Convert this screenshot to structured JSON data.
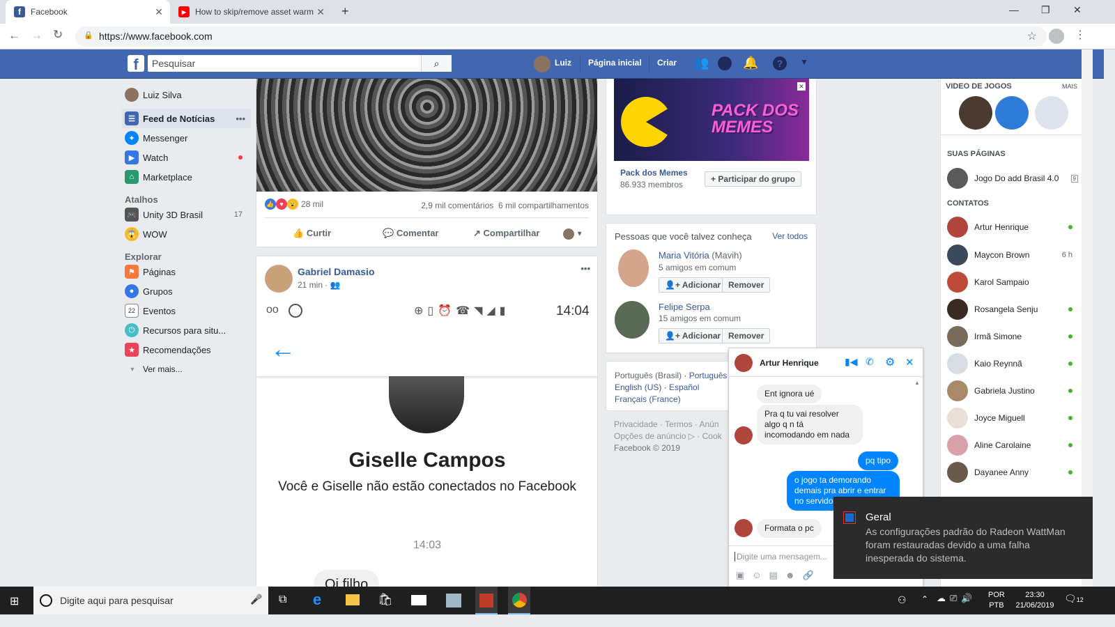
{
  "browser": {
    "tabs": [
      {
        "title": "Facebook",
        "icon": "facebook-icon"
      },
      {
        "title": "How to skip/remove asset warmu",
        "icon": "youtube-icon"
      }
    ],
    "url": "https://www.facebook.com"
  },
  "header": {
    "search_placeholder": "Pesquisar",
    "user_name": "Luiz",
    "home": "Página inicial",
    "create": "Criar"
  },
  "left_nav": {
    "profile": "Luiz Silva",
    "main": [
      {
        "label": "Feed de Notícias",
        "icon": "news-feed-icon"
      },
      {
        "label": "Messenger",
        "icon": "messenger-icon"
      },
      {
        "label": "Watch",
        "icon": "watch-icon"
      },
      {
        "label": "Marketplace",
        "icon": "marketplace-icon"
      }
    ],
    "shortcuts_header": "Atalhos",
    "shortcuts": [
      {
        "label": "Unity 3D Brasil",
        "count": "17"
      },
      {
        "label": "WOW",
        "count": ""
      }
    ],
    "explore_header": "Explorar",
    "explore": [
      {
        "label": "Páginas"
      },
      {
        "label": "Grupos"
      },
      {
        "label": "Eventos"
      },
      {
        "label": "Recursos para situ..."
      },
      {
        "label": "Recomendações"
      }
    ],
    "see_more": "Ver mais..."
  },
  "post1": {
    "reactions": "28 mil",
    "comments": "2,9 mil comentários",
    "shares": "6 mil compartilhamentos",
    "like": "Curtir",
    "comment": "Comentar",
    "share": "Compartilhar"
  },
  "post2": {
    "author": "Gabriel Damasio",
    "time": "21 min",
    "phone_time": "14:04",
    "profile_name": "Giselle Campos",
    "profile_sub": "Você e Giselle não estão conectados no Facebook",
    "msg_time": "14:03",
    "msg": "Oi filho"
  },
  "group_ad": {
    "banner_text": "PACK DOS MEMES",
    "name": "Pack dos Memes",
    "members": "86.933 membros",
    "join": "Participar do grupo"
  },
  "pymk": {
    "title": "Pessoas que você talvez conheça",
    "see_all": "Ver todos",
    "people": [
      {
        "name": "Maria Vitória",
        "alt": "(Mavih)",
        "mutual": "5 amigos em comum"
      },
      {
        "name": "Felipe Serpa",
        "alt": "",
        "mutual": "15 amigos em comum"
      }
    ],
    "add": "Adicionar",
    "remove": "Remover"
  },
  "footer": {
    "lang_current": "Português (Brasil)",
    "langs": [
      "Português",
      "English (US)",
      "Español",
      "Français (France)"
    ],
    "line1": "Privacidade · Termos · Anún",
    "line2": "Opções de anúncio ▷ · Cook",
    "copyright": "Facebook © 2019"
  },
  "right_sidebar": {
    "games_header": "VIDEO DE JOGOS",
    "more": "MAIS",
    "pages_header": "SUAS PÁGINAS",
    "page": "Jogo Do add Brasil 4.0",
    "page_badge": "9",
    "contacts_header": "CONTATOS",
    "contacts": [
      {
        "name": "Artur Henrique",
        "status": "online"
      },
      {
        "name": "Maycon Brown",
        "status": "6 h"
      },
      {
        "name": "Karol Sampaio",
        "status": ""
      },
      {
        "name": "Rosangela Senju",
        "status": "online"
      },
      {
        "name": "Irmã Simone",
        "status": "online"
      },
      {
        "name": "Kaio Reynnã",
        "status": "online"
      },
      {
        "name": "Gabriela Justino",
        "status": "online"
      },
      {
        "name": "Joyce Miguell",
        "status": "online"
      },
      {
        "name": "Aline Carolaine",
        "status": "online"
      },
      {
        "name": "Dayanee Anny",
        "status": "online"
      }
    ]
  },
  "chat": {
    "name": "Artur Henrique",
    "messages": [
      {
        "from": "them",
        "text": "Ent ignora ué"
      },
      {
        "from": "them",
        "text": "Pra q tu vai resolver algo q n tá incomodando em nada"
      },
      {
        "from": "me",
        "text": "pq tipo"
      },
      {
        "from": "me",
        "text": "o jogo ta demorando demais pra abrir e entrar no servidor"
      },
      {
        "from": "them",
        "text": "Formata o pc"
      }
    ],
    "input_placeholder": "Digite uma mensagem..."
  },
  "toast": {
    "title": "Geral",
    "body": "As configurações padrão do Radeon WattMan foram restauradas devido a uma falha inesperada do sistema."
  },
  "taskbar": {
    "search_placeholder": "Digite aqui para pesquisar",
    "lang1": "POR",
    "lang2": "PTB",
    "time": "23:30",
    "date": "21/06/2019",
    "notif_count": "12"
  }
}
